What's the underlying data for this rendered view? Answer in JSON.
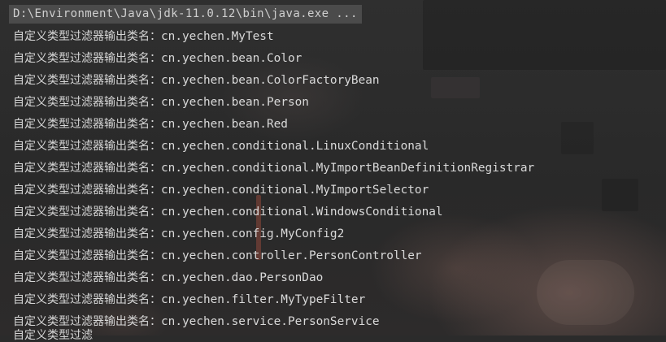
{
  "console": {
    "command_path": "D:\\Environment\\Java\\jdk-11.0.12\\bin\\java.exe ...",
    "lines": [
      {
        "label": "自定义类型过滤器输出类名：",
        "class_name": "cn.yechen.MyTest"
      },
      {
        "label": "自定义类型过滤器输出类名：",
        "class_name": "cn.yechen.bean.Color"
      },
      {
        "label": "自定义类型过滤器输出类名：",
        "class_name": "cn.yechen.bean.ColorFactoryBean"
      },
      {
        "label": "自定义类型过滤器输出类名：",
        "class_name": "cn.yechen.bean.Person"
      },
      {
        "label": "自定义类型过滤器输出类名：",
        "class_name": "cn.yechen.bean.Red"
      },
      {
        "label": "自定义类型过滤器输出类名：",
        "class_name": "cn.yechen.conditional.LinuxConditional"
      },
      {
        "label": "自定义类型过滤器输出类名：",
        "class_name": "cn.yechen.conditional.MyImportBeanDefinitionRegistrar"
      },
      {
        "label": "自定义类型过滤器输出类名：",
        "class_name": "cn.yechen.conditional.MyImportSelector"
      },
      {
        "label": "自定义类型过滤器输出类名：",
        "class_name": "cn.yechen.conditional.WindowsConditional"
      },
      {
        "label": "自定义类型过滤器输出类名：",
        "class_name": "cn.yechen.config.MyConfig2"
      },
      {
        "label": "自定义类型过滤器输出类名：",
        "class_name": "cn.yechen.controller.PersonController"
      },
      {
        "label": "自定义类型过滤器输出类名：",
        "class_name": "cn.yechen.dao.PersonDao"
      },
      {
        "label": "自定义类型过滤器输出类名：",
        "class_name": "cn.yechen.filter.MyTypeFilter"
      },
      {
        "label": "自定义类型过滤器输出类名：",
        "class_name": "cn.yechen.service.PersonService"
      }
    ],
    "partial_line": "自定义类型过滤"
  },
  "colors": {
    "background": "#2b2b2b",
    "path_highlight": "#4b4b4b",
    "text": "#d9d9d9"
  }
}
